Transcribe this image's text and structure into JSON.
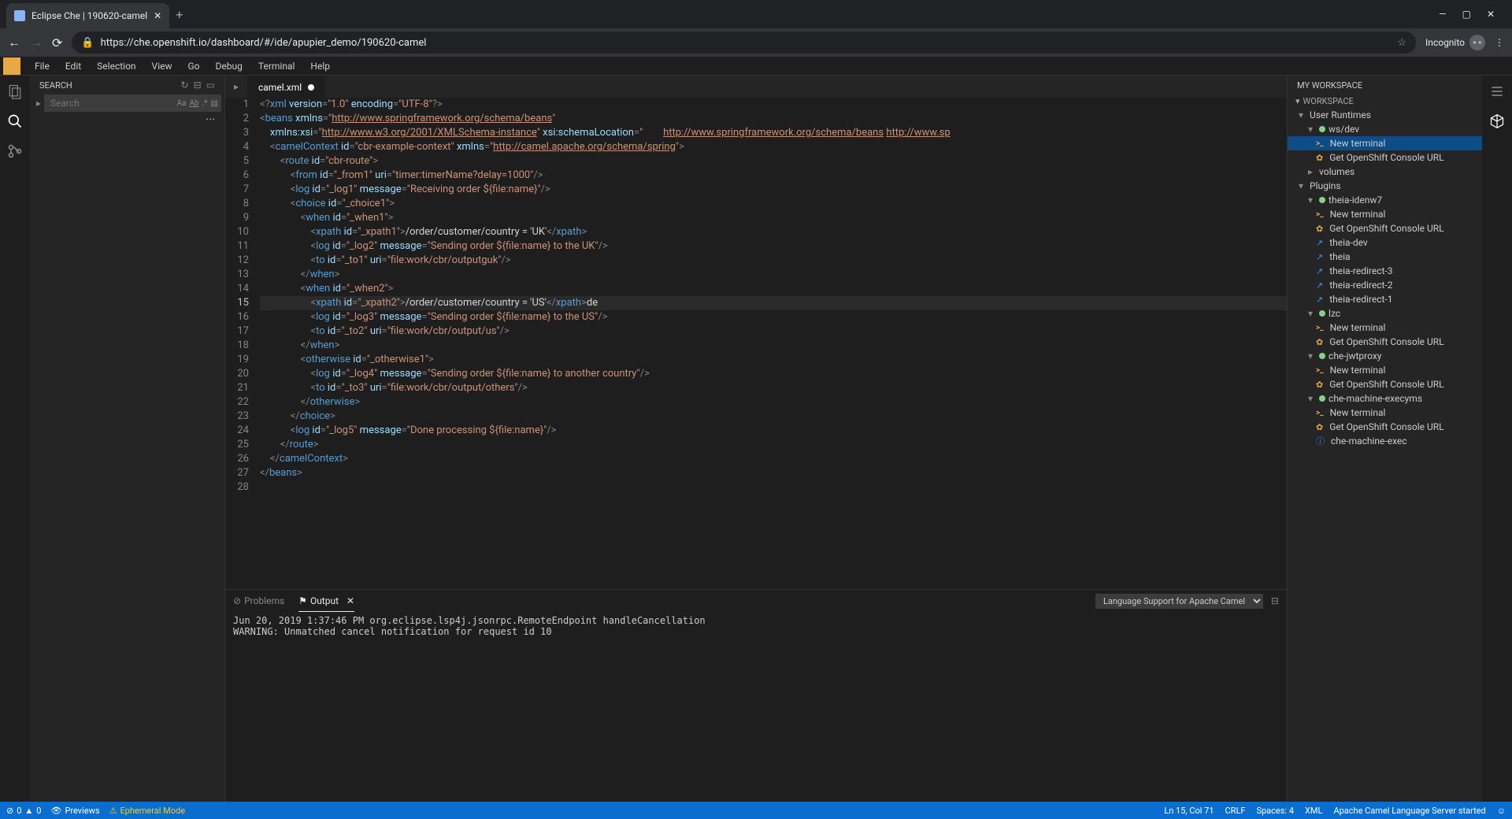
{
  "browser": {
    "tab_title": "Eclipse Che | 190620-camel",
    "url": "https://che.openshift.io/dashboard/#/ide/apupier_demo/190620-camel",
    "incognito_text": "Incognito"
  },
  "menubar": [
    "File",
    "Edit",
    "Selection",
    "View",
    "Go",
    "Debug",
    "Terminal",
    "Help"
  ],
  "search": {
    "title": "SEARCH",
    "placeholder": "Search"
  },
  "editor": {
    "tab": "camel.xml",
    "current_line": 15,
    "lines": [
      {
        "n": 1,
        "html": "<span class='tk-del'>&lt;?</span><span class='tk-tag'>xml</span> <span class='tk-attr'>version</span><span class='tk-del'>=</span><span class='tk-str'>\"1.0\"</span> <span class='tk-attr'>encoding</span><span class='tk-del'>=</span><span class='tk-str'>\"UTF-8\"</span><span class='tk-del'>?&gt;</span>"
      },
      {
        "n": 2,
        "html": "<span class='tk-del'>&lt;</span><span class='tk-tag'>beans</span> <span class='tk-attr'>xmlns</span><span class='tk-del'>=</span><span class='tk-str'>\"</span><span class='tk-link'>http://www.springframework.org/schema/beans</span><span class='tk-str'>\"</span>"
      },
      {
        "n": 3,
        "html": "    <span class='tk-attr'>xmlns:xsi</span><span class='tk-del'>=</span><span class='tk-str'>\"</span><span class='tk-link'>http://www.w3.org/2001/XMLSchema-instance</span><span class='tk-str'>\"</span> <span class='tk-attr'>xsi:schemaLocation</span><span class='tk-del'>=</span><span class='tk-str'>\"</span>        <span class='tk-link'>http://www.springframework.org/schema/beans</span> <span class='tk-link'>http://www.sp</span>"
      },
      {
        "n": 4,
        "html": "    <span class='tk-del'>&lt;</span><span class='tk-tag'>camelContext</span> <span class='tk-attr'>id</span><span class='tk-del'>=</span><span class='tk-str'>\"cbr-example-context\"</span> <span class='tk-attr'>xmlns</span><span class='tk-del'>=</span><span class='tk-str'>\"</span><span class='tk-link'>http://camel.apache.org/schema/spring</span><span class='tk-str'>\"</span><span class='tk-del'>&gt;</span>"
      },
      {
        "n": 5,
        "html": "        <span class='tk-del'>&lt;</span><span class='tk-tag'>route</span> <span class='tk-attr'>id</span><span class='tk-del'>=</span><span class='tk-str'>\"cbr-route\"</span><span class='tk-del'>&gt;</span>"
      },
      {
        "n": 6,
        "html": "            <span class='tk-del'>&lt;</span><span class='tk-tag'>from</span> <span class='tk-attr'>id</span><span class='tk-del'>=</span><span class='tk-str'>\"_from1\"</span> <span class='tk-attr'>uri</span><span class='tk-del'>=</span><span class='tk-str'>\"timer:timerName?delay=1000\"</span><span class='tk-del'>/&gt;</span>"
      },
      {
        "n": 7,
        "html": "            <span class='tk-del'>&lt;</span><span class='tk-tag'>log</span> <span class='tk-attr'>id</span><span class='tk-del'>=</span><span class='tk-str'>\"_log1\"</span> <span class='tk-attr'>message</span><span class='tk-del'>=</span><span class='tk-str'>\"Receiving order ${file:name}\"</span><span class='tk-del'>/&gt;</span>"
      },
      {
        "n": 8,
        "html": "            <span class='tk-del'>&lt;</span><span class='tk-tag'>choice</span> <span class='tk-attr'>id</span><span class='tk-del'>=</span><span class='tk-str'>\"_choice1\"</span><span class='tk-del'>&gt;</span>"
      },
      {
        "n": 9,
        "html": "                <span class='tk-del'>&lt;</span><span class='tk-tag'>when</span> <span class='tk-attr'>id</span><span class='tk-del'>=</span><span class='tk-str'>\"_when1\"</span><span class='tk-del'>&gt;</span>"
      },
      {
        "n": 10,
        "html": "                    <span class='tk-del'>&lt;</span><span class='tk-tag'>xpath</span> <span class='tk-attr'>id</span><span class='tk-del'>=</span><span class='tk-str'>\"_xpath1\"</span><span class='tk-del'>&gt;</span><span class='tk-txt'>/order/customer/country = 'UK'</span><span class='tk-del'>&lt;/</span><span class='tk-tag'>xpath</span><span class='tk-del'>&gt;</span>"
      },
      {
        "n": 11,
        "html": "                    <span class='tk-del'>&lt;</span><span class='tk-tag'>log</span> <span class='tk-attr'>id</span><span class='tk-del'>=</span><span class='tk-str'>\"_log2\"</span> <span class='tk-attr'>message</span><span class='tk-del'>=</span><span class='tk-str'>\"Sending order ${file:name} to the UK\"</span><span class='tk-del'>/&gt;</span>"
      },
      {
        "n": 12,
        "html": "                    <span class='tk-del'>&lt;</span><span class='tk-tag'>to</span> <span class='tk-attr'>id</span><span class='tk-del'>=</span><span class='tk-str'>\"_to1\"</span> <span class='tk-attr'>uri</span><span class='tk-del'>=</span><span class='tk-str'>\"file:work/cbr/outputguk\"</span><span class='tk-del'>/&gt;</span>"
      },
      {
        "n": 13,
        "html": "                <span class='tk-del'>&lt;/</span><span class='tk-tag'>when</span><span class='tk-del'>&gt;</span>"
      },
      {
        "n": 14,
        "html": "                <span class='tk-del'>&lt;</span><span class='tk-tag'>when</span> <span class='tk-attr'>id</span><span class='tk-del'>=</span><span class='tk-str'>\"_when2\"</span><span class='tk-del'>&gt;</span>"
      },
      {
        "n": 15,
        "html": "                    <span class='tk-del'>&lt;</span><span class='tk-tag'>xpath</span> <span class='tk-attr'>id</span><span class='tk-del'>=</span><span class='tk-str'>\"_xpath2\"</span><span class='tk-del'>&gt;</span><span class='tk-txt'>/order/customer/country = 'US'</span><span class='tk-del'>&lt;/</span><span class='tk-tag'>xpath</span><span class='tk-del'>&gt;</span><span class='tk-txt'>de</span>"
      },
      {
        "n": 16,
        "html": "                    <span class='tk-del'>&lt;</span><span class='tk-tag'>log</span> <span class='tk-attr'>id</span><span class='tk-del'>=</span><span class='tk-str'>\"_log3\"</span> <span class='tk-attr'>message</span><span class='tk-del'>=</span><span class='tk-str'>\"Sending order ${file:name} to the US\"</span><span class='tk-del'>/&gt;</span>"
      },
      {
        "n": 17,
        "html": "                    <span class='tk-del'>&lt;</span><span class='tk-tag'>to</span> <span class='tk-attr'>id</span><span class='tk-del'>=</span><span class='tk-str'>\"_to2\"</span> <span class='tk-attr'>uri</span><span class='tk-del'>=</span><span class='tk-str'>\"file:work/cbr/output/us\"</span><span class='tk-del'>/&gt;</span>"
      },
      {
        "n": 18,
        "html": "                <span class='tk-del'>&lt;/</span><span class='tk-tag'>when</span><span class='tk-del'>&gt;</span>"
      },
      {
        "n": 19,
        "html": "                <span class='tk-del'>&lt;</span><span class='tk-tag'>otherwise</span> <span class='tk-attr'>id</span><span class='tk-del'>=</span><span class='tk-str'>\"_otherwise1\"</span><span class='tk-del'>&gt;</span>"
      },
      {
        "n": 20,
        "html": "                    <span class='tk-del'>&lt;</span><span class='tk-tag'>log</span> <span class='tk-attr'>id</span><span class='tk-del'>=</span><span class='tk-str'>\"_log4\"</span> <span class='tk-attr'>message</span><span class='tk-del'>=</span><span class='tk-str'>\"Sending order ${file:name} to another country\"</span><span class='tk-del'>/&gt;</span>"
      },
      {
        "n": 21,
        "html": "                    <span class='tk-del'>&lt;</span><span class='tk-tag'>to</span> <span class='tk-attr'>id</span><span class='tk-del'>=</span><span class='tk-str'>\"_to3\"</span> <span class='tk-attr'>uri</span><span class='tk-del'>=</span><span class='tk-str'>\"file:work/cbr/output/others\"</span><span class='tk-del'>/&gt;</span>"
      },
      {
        "n": 22,
        "html": "                <span class='tk-del'>&lt;/</span><span class='tk-tag'>otherwise</span><span class='tk-del'>&gt;</span>"
      },
      {
        "n": 23,
        "html": "            <span class='tk-del'>&lt;/</span><span class='tk-tag'>choice</span><span class='tk-del'>&gt;</span>"
      },
      {
        "n": 24,
        "html": "            <span class='tk-del'>&lt;</span><span class='tk-tag'>log</span> <span class='tk-attr'>id</span><span class='tk-del'>=</span><span class='tk-str'>\"_log5\"</span> <span class='tk-attr'>message</span><span class='tk-del'>=</span><span class='tk-str'>\"Done processing ${file:name}\"</span><span class='tk-del'>/&gt;</span>"
      },
      {
        "n": 25,
        "html": "        <span class='tk-del'>&lt;/</span><span class='tk-tag'>route</span><span class='tk-del'>&gt;</span>"
      },
      {
        "n": 26,
        "html": "    <span class='tk-del'>&lt;/</span><span class='tk-tag'>camelContext</span><span class='tk-del'>&gt;</span>"
      },
      {
        "n": 27,
        "html": "<span class='tk-del'>&lt;/</span><span class='tk-tag'>beans</span><span class='tk-del'>&gt;</span>"
      },
      {
        "n": 28,
        "html": ""
      }
    ]
  },
  "panel": {
    "problems": "Problems",
    "output": "Output",
    "selector": "Language Support for Apache Camel",
    "content": "Jun 20, 2019 1:37:46 PM org.eclipse.lsp4j.jsonrpc.RemoteEndpoint handleCancellation\nWARNING: Unmatched cancel notification for request id 10"
  },
  "workspace": {
    "title": "MY WORKSPACE",
    "section": "WORKSPACE",
    "user_runtimes": "User Runtimes",
    "volumes": "volumes",
    "plugins": "Plugins",
    "tree": [
      {
        "t": "header",
        "label": "ws/dev",
        "indent": 1,
        "icon": "dot"
      },
      {
        "t": "cmd",
        "label": "New terminal",
        "indent": 2,
        "icon": "term",
        "sel": true
      },
      {
        "t": "cmd",
        "label": "Get OpenShift Console URL",
        "indent": 2,
        "icon": "os"
      },
      {
        "t": "header",
        "label": "theia-idenw7",
        "indent": 1,
        "icon": "dot"
      },
      {
        "t": "cmd",
        "label": "New terminal",
        "indent": 2,
        "icon": "term"
      },
      {
        "t": "cmd",
        "label": "Get OpenShift Console URL",
        "indent": 2,
        "icon": "os"
      },
      {
        "t": "cmd",
        "label": "theia-dev",
        "indent": 2,
        "icon": "link"
      },
      {
        "t": "cmd",
        "label": "theia",
        "indent": 2,
        "icon": "link"
      },
      {
        "t": "cmd",
        "label": "theia-redirect-3",
        "indent": 2,
        "icon": "link"
      },
      {
        "t": "cmd",
        "label": "theia-redirect-2",
        "indent": 2,
        "icon": "link"
      },
      {
        "t": "cmd",
        "label": "theia-redirect-1",
        "indent": 2,
        "icon": "link"
      },
      {
        "t": "header",
        "label": "lzc",
        "indent": 1,
        "icon": "dot"
      },
      {
        "t": "cmd",
        "label": "New terminal",
        "indent": 2,
        "icon": "term"
      },
      {
        "t": "cmd",
        "label": "Get OpenShift Console URL",
        "indent": 2,
        "icon": "os"
      },
      {
        "t": "header",
        "label": "che-jwtproxy",
        "indent": 1,
        "icon": "dot"
      },
      {
        "t": "cmd",
        "label": "New terminal",
        "indent": 2,
        "icon": "term"
      },
      {
        "t": "cmd",
        "label": "Get OpenShift Console URL",
        "indent": 2,
        "icon": "os"
      },
      {
        "t": "header",
        "label": "che-machine-execyms",
        "indent": 1,
        "icon": "dot"
      },
      {
        "t": "cmd",
        "label": "New terminal",
        "indent": 2,
        "icon": "term"
      },
      {
        "t": "cmd",
        "label": "Get OpenShift Console URL",
        "indent": 2,
        "icon": "os"
      },
      {
        "t": "cmd",
        "label": "che-machine-exec",
        "indent": 2,
        "icon": "info"
      }
    ]
  },
  "status": {
    "errors": "0",
    "warnings": "0",
    "previews": "Previews",
    "ephemeral": "Ephemeral Mode",
    "lncol": "Ln 15, Col 71",
    "eol": "CRLF",
    "spaces": "Spaces: 4",
    "lang": "XML",
    "server": "Apache Camel Language Server started"
  }
}
